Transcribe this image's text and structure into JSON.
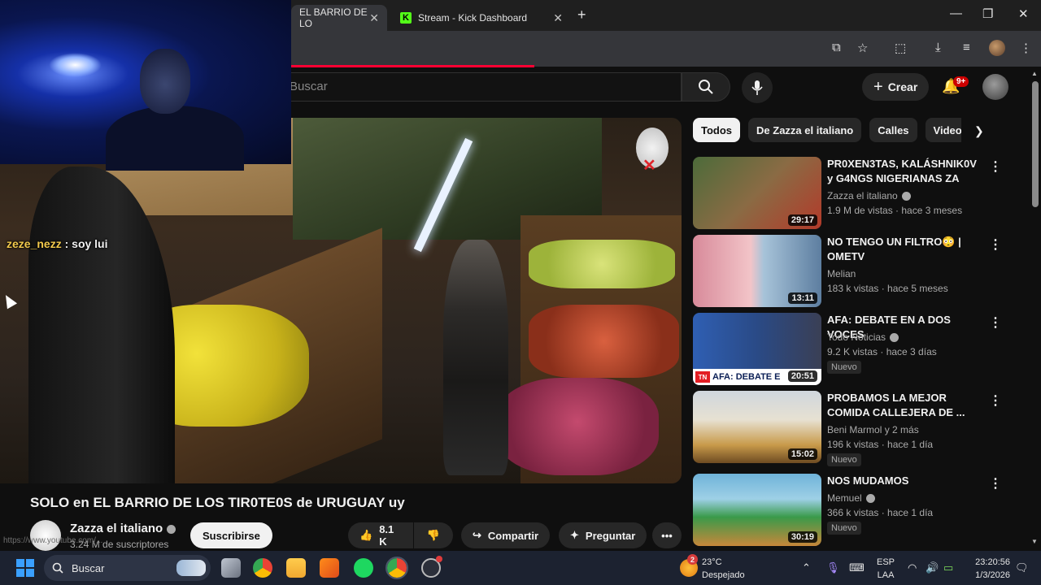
{
  "browser": {
    "tabs": [
      {
        "title": "EL BARRIO DE LO"
      },
      {
        "title": "Stream - Kick Dashboard"
      }
    ],
    "new_tab": "+",
    "close": "✕"
  },
  "youtube_header": {
    "search_placeholder": "Buscar",
    "create_label": "Crear",
    "notifications_badge": "9+"
  },
  "chat_overlay": {
    "user": "zeze_nezz",
    "message": "soy lui"
  },
  "video": {
    "title": "SOLO en EL BARRIO DE LOS TIR0TE0S de URUGUAY uy",
    "channel": "Zazza el italiano",
    "subscribers": "3.24 M de suscriptores",
    "subscribe_label": "Suscribirse",
    "likes": "8.1 K",
    "share_label": "Compartir",
    "ask_label": "Preguntar",
    "more_label": "•••",
    "status_url": "https://www.youtube.com/..."
  },
  "sidebar": {
    "chips": [
      "Todos",
      "De Zazza el italiano",
      "Calles",
      "Videos"
    ],
    "recommendations": [
      {
        "title": "PR0XEN3TAS, KALÁSHNIK0V y G4NGS NIGERIANAS ZA",
        "channel": "Zazza el italiano",
        "verified": true,
        "meta": "1.9 M de vistas · hace 3 meses",
        "duration": "29:17",
        "new": false
      },
      {
        "title": "NO TENGO UN FILTRO😳 | OMETV",
        "channel": "Melian",
        "verified": false,
        "meta": "183 k vistas · hace 5 meses",
        "duration": "13:11",
        "new": false
      },
      {
        "title": "AFA: DEBATE EN A DOS VOCES",
        "channel": "Todo Noticias",
        "verified": true,
        "meta": "9.2 K vistas · hace 3 días",
        "duration": "20:51",
        "new": true,
        "new_label": "Nuevo",
        "thumb_text": "AFA: DEBATE E"
      },
      {
        "title": "PROBAMOS LA MEJOR COMIDA CALLEJERA DE ...",
        "channel": "Beni Marmol y 2 más",
        "verified": false,
        "meta": "196 k vistas · hace 1 día",
        "duration": "15:02",
        "new": true,
        "new_label": "Nuevo"
      },
      {
        "title": "NOS MUDAMOS",
        "channel": "Memuel",
        "verified": true,
        "meta": "366 k vistas · hace 1 día",
        "duration": "30:19",
        "new": true,
        "new_label": "Nuevo"
      }
    ]
  },
  "taskbar": {
    "search_label": "Buscar",
    "weather_temp": "23°C",
    "weather_desc": "Despejado",
    "weather_badge": "2",
    "lang_top": "ESP",
    "lang_bottom": "LAA",
    "time": "23:20:56",
    "date": "1/3/2026"
  },
  "colors": {
    "yt_red": "#ff0033",
    "kick_green": "#53fc18",
    "chat_user": "#f2c94c"
  }
}
